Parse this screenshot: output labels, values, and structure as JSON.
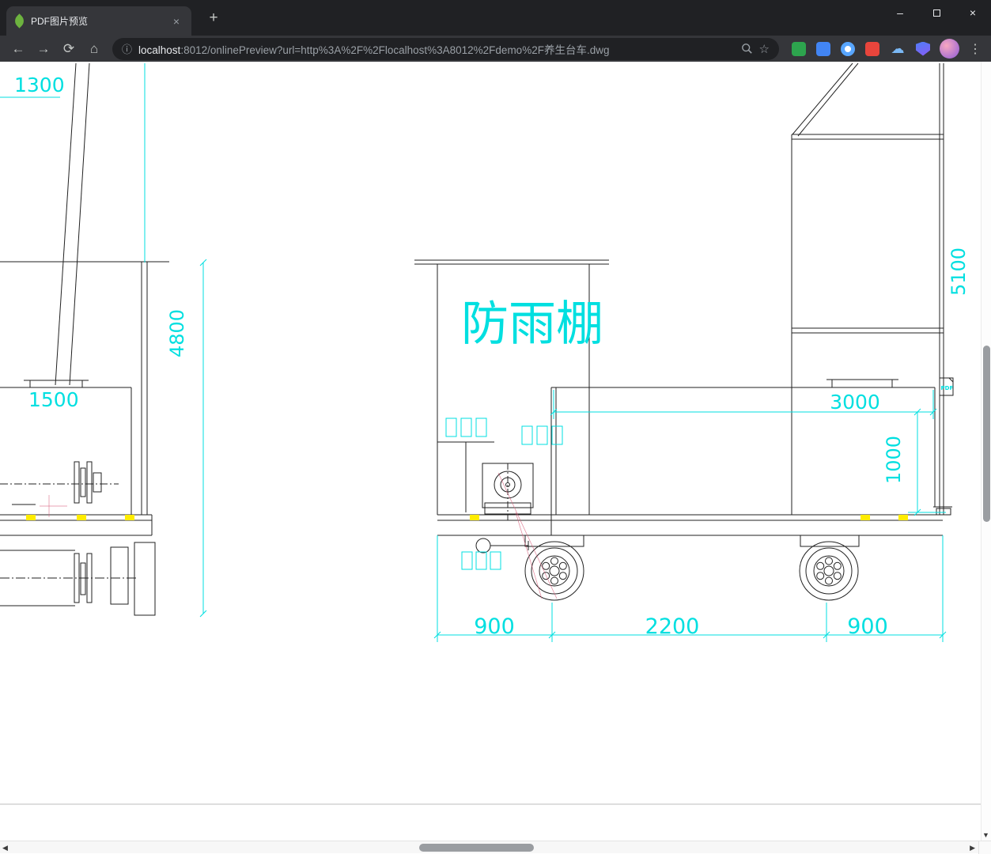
{
  "browser": {
    "tab_title": "PDF图片预览",
    "url": {
      "host": "localhost",
      "rest": ":8012/onlinePreview?url=http%3A%2F%2Flocalhost%3A8012%2Fdemo%2F养生台车.dwg"
    }
  },
  "icons": {
    "minimize": "–",
    "close_window": "×",
    "tab_close": "×",
    "new_tab": "+",
    "back": "←",
    "forward": "→",
    "reload": "⟳",
    "home": "⌂",
    "info": "ⓘ",
    "star": "☆",
    "cloud_ext": "☁",
    "menu": "⋮",
    "scroll_left": "◀",
    "scroll_right": "▶",
    "scroll_down": "▼"
  },
  "drawing": {
    "shed_label": "防雨棚",
    "pdf_badge": "PDF",
    "dims": {
      "d1300": "1300",
      "d1500": "1500",
      "d4800": "4800",
      "d5100": "5100",
      "d3000": "3000",
      "d1000": "1000",
      "d900_left": "900",
      "d2200": "2200",
      "d900_right": "900"
    }
  }
}
